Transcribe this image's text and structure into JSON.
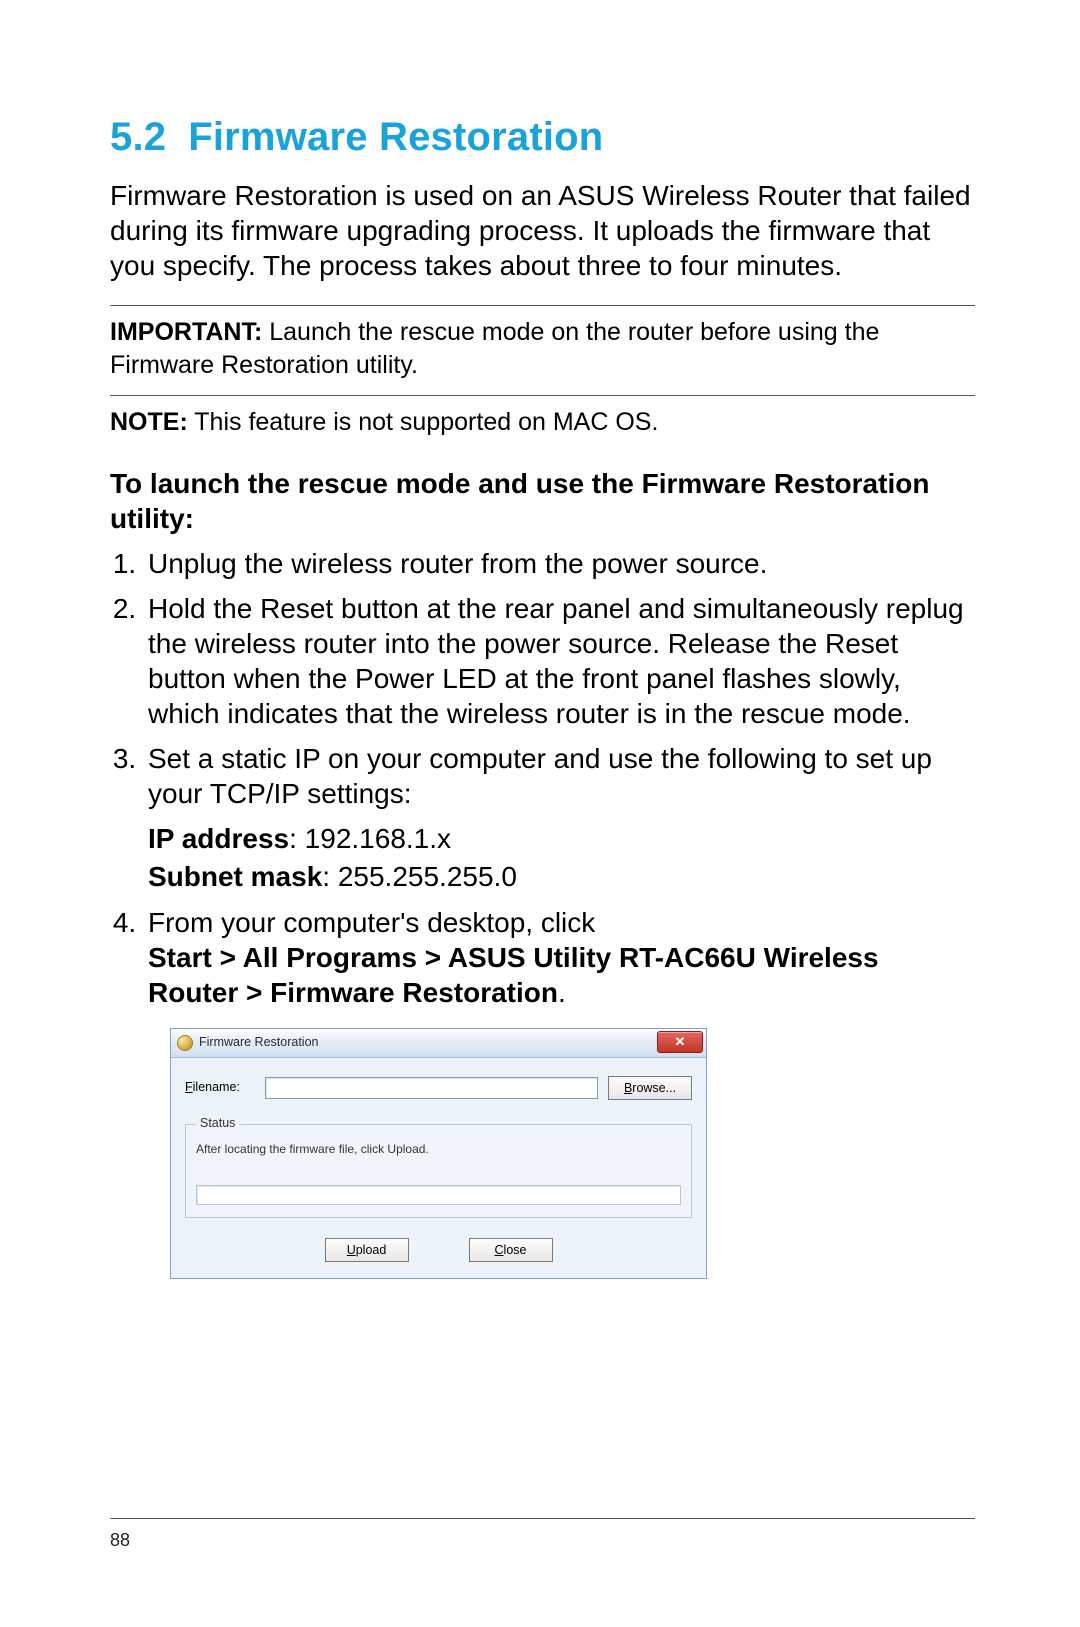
{
  "heading": {
    "number": "5.2",
    "title": "Firmware Restoration"
  },
  "intro": "Firmware Restoration is used on an ASUS Wireless Router that failed during its firmware upgrading process. It uploads the firmware that you specify. The process takes about three to four minutes.",
  "important": {
    "label": "IMPORTANT:",
    "text": "Launch the rescue mode on the router before using the Firmware Restoration utility."
  },
  "note": {
    "label": "NOTE:",
    "text": "This feature is not supported on MAC OS."
  },
  "procedure_heading": "To launch the rescue mode and use the Firmware Restoration utility:",
  "steps": {
    "s1": "Unplug the wireless router from the power source.",
    "s2": "Hold the Reset button at the rear panel and simultaneously replug the wireless router into the power source. Release the Reset button when the Power LED at the front panel flashes slowly, which indicates that the wireless router is in the rescue mode.",
    "s3": "Set a static IP on your computer and use the following to set up your TCP/IP settings:",
    "ip_label": "IP address",
    "ip_value": ": 192.168.1.x",
    "mask_label": "Subnet mask",
    "mask_value": ": 255.255.255.0",
    "s4_lead": "From your computer's desktop, click ",
    "s4_path": "Start > All Programs > ASUS Utility RT-AC66U Wireless Router > Firmware Restoration",
    "s4_tail": "."
  },
  "dialog": {
    "title": "Firmware Restoration",
    "filename_label_u": "F",
    "filename_label_rest": "ilename:",
    "filename_value": "",
    "browse_u": "B",
    "browse_rest": "rowse...",
    "status_legend": "Status",
    "status_text": "After locating the firmware file, click Upload.",
    "upload_u": "U",
    "upload_rest": "pload",
    "close_u": "C",
    "close_rest": "lose"
  },
  "page_number": "88"
}
